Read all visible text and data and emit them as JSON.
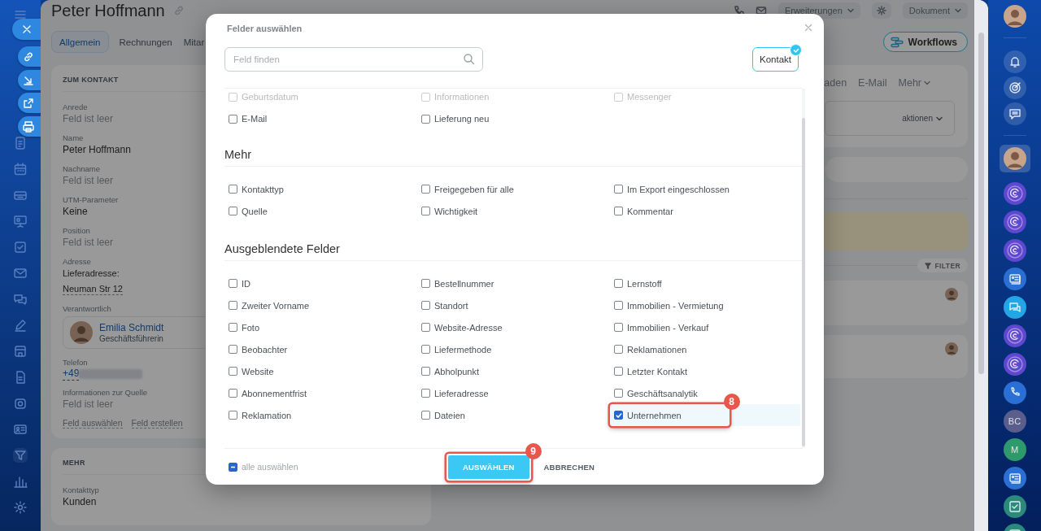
{
  "page": {
    "title": "Peter Hoffmann",
    "tabs": [
      {
        "label": "Allgemein",
        "selected": true
      },
      {
        "label": "Rechnungen",
        "selected": false
      },
      {
        "label": "Mitar",
        "selected": false
      }
    ],
    "extensions_menu": "Erweiterungen",
    "document_menu": "Dokument",
    "workflows_button": "Workflows",
    "contact_card": {
      "heading": "ZUM KONTAKT",
      "fields": [
        {
          "kind": "text",
          "label": "Anrede",
          "value": "Feld ist leer",
          "empty": true
        },
        {
          "kind": "text",
          "label": "Name",
          "value": "Peter Hoffmann",
          "empty": false
        },
        {
          "kind": "text",
          "label": "Nachname",
          "value": "Feld ist leer",
          "empty": true
        },
        {
          "kind": "text",
          "label": "UTM-Parameter",
          "value": "Keine",
          "empty": false
        },
        {
          "kind": "text",
          "label": "Position",
          "value": "Feld ist leer",
          "empty": true
        },
        {
          "kind": "address",
          "label": "Adresse",
          "sublabel": "Lieferadresse:",
          "value": "Neuman Str 12"
        },
        {
          "kind": "person",
          "label": "Verantwortlich",
          "name": "Emilia Schmidt",
          "role": "Geschäftsführerin"
        },
        {
          "kind": "phone",
          "label": "Telefon",
          "value": "+49"
        },
        {
          "kind": "text",
          "label": "Informationen zur Quelle",
          "value": "Feld ist leer",
          "empty": true
        }
      ],
      "links": [
        "Feld auswählen",
        "Feld erstellen"
      ]
    },
    "more_card": {
      "heading": "MEHR",
      "fields": [
        {
          "kind": "text",
          "label": "Kontakttyp",
          "value": "Kunden",
          "empty": false
        }
      ]
    },
    "activity_tabs": [
      {
        "label": "aden",
        "dropdown": false
      },
      {
        "label": "E-Mail",
        "dropdown": false
      },
      {
        "label": "Mehr",
        "dropdown": true
      }
    ],
    "actions_label": "aktionen",
    "filter_button": "FILTER"
  },
  "right_bar": {
    "avatars": [
      {
        "initials": "BC",
        "color": "#5a5e8c"
      },
      {
        "initials": "M",
        "color": "#2e9a6c"
      }
    ]
  },
  "modal": {
    "title": "Felder auswählen",
    "search": {
      "placeholder": "Feld finden"
    },
    "entity_button": {
      "label": "Kontakt",
      "selected": true
    },
    "sections": [
      {
        "fields": [
          {
            "label": "Geburtsdatum",
            "checked": false
          },
          {
            "label": "Informationen",
            "checked": false
          },
          {
            "label": "Messenger",
            "checked": false
          },
          {
            "label": "E-Mail",
            "checked": false
          },
          {
            "label": "Lieferung neu",
            "checked": false
          }
        ]
      },
      {
        "heading": "Mehr",
        "fields": [
          {
            "label": "Kontakttyp",
            "checked": false
          },
          {
            "label": "Freigegeben für alle",
            "checked": false
          },
          {
            "label": "Im Export eingeschlossen",
            "checked": false
          },
          {
            "label": "Quelle",
            "checked": false
          },
          {
            "label": "Wichtigkeit",
            "checked": false
          },
          {
            "label": "Kommentar",
            "checked": false
          }
        ]
      },
      {
        "heading": "Ausgeblendete Felder",
        "fields": [
          {
            "label": "ID",
            "checked": false
          },
          {
            "label": "Bestellnummer",
            "checked": false
          },
          {
            "label": "Lernstoff",
            "checked": false
          },
          {
            "label": "Zweiter Vorname",
            "checked": false
          },
          {
            "label": "Standort",
            "checked": false
          },
          {
            "label": "Immobilien - Vermietung",
            "checked": false
          },
          {
            "label": "Foto",
            "checked": false
          },
          {
            "label": "Website-Adresse",
            "checked": false
          },
          {
            "label": "Immobilien - Verkauf",
            "checked": false
          },
          {
            "label": "Beobachter",
            "checked": false
          },
          {
            "label": "Liefermethode",
            "checked": false
          },
          {
            "label": "Reklamationen",
            "checked": false
          },
          {
            "label": "Website",
            "checked": false
          },
          {
            "label": "Abholpunkt",
            "checked": false
          },
          {
            "label": "Letzter Kontakt",
            "checked": false
          },
          {
            "label": "Abonnementfrist",
            "checked": false
          },
          {
            "label": "Lieferadresse",
            "checked": false
          },
          {
            "label": "Geschäftsanalytik",
            "checked": false
          },
          {
            "label": "Reklamation",
            "checked": false
          },
          {
            "label": "Dateien",
            "checked": false
          },
          {
            "label": "Unternehmen",
            "checked": true,
            "annotation": "8"
          }
        ]
      }
    ],
    "select_all": {
      "label": "alle auswählen",
      "indeterminate": true
    },
    "buttons": [
      {
        "label": "AUSWÄHLEN",
        "kind": "primary",
        "annotation": "9"
      },
      {
        "label": "ABBRECHEN",
        "kind": "link"
      }
    ]
  }
}
